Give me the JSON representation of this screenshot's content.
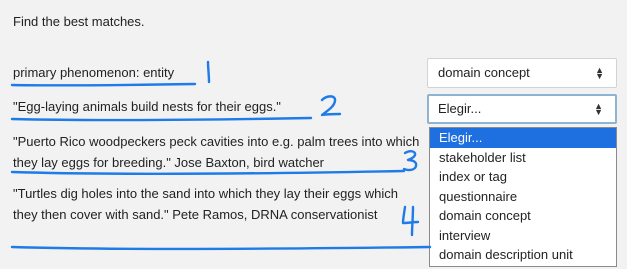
{
  "instruction": "Find the best matches.",
  "questions": [
    {
      "stem": "primary phenomenon: entity",
      "selected": "domain concept",
      "annotation": "1"
    },
    {
      "stem": "\"Egg-laying animals build nests for their eggs.\"",
      "selected": "Elegir...",
      "annotation": "2"
    },
    {
      "stem": "\"Puerto Rico woodpeckers peck cavities into e.g. palm trees into which they lay eggs for breeding.\" Jose Baxton, bird watcher",
      "annotation": "3"
    },
    {
      "stem": "\"Turtles dig holes into the sand into which they lay their eggs which they then cover with sand.\" Pete Ramos, DRNA conservationist",
      "annotation": "4"
    }
  ],
  "dropdown": {
    "options": [
      "Elegir...",
      "stakeholder list",
      "index or tag",
      "questionnaire",
      "domain concept",
      "interview",
      "domain description unit"
    ],
    "highlighted": "Elegir..."
  },
  "icons": {
    "select_caret": "up-down-caret-icon"
  },
  "colors": {
    "background": "#f2f2f2",
    "focus_border": "#8fb4d2",
    "option_highlight": "#1e6fe0",
    "annotation_ink": "#1e7be8"
  }
}
